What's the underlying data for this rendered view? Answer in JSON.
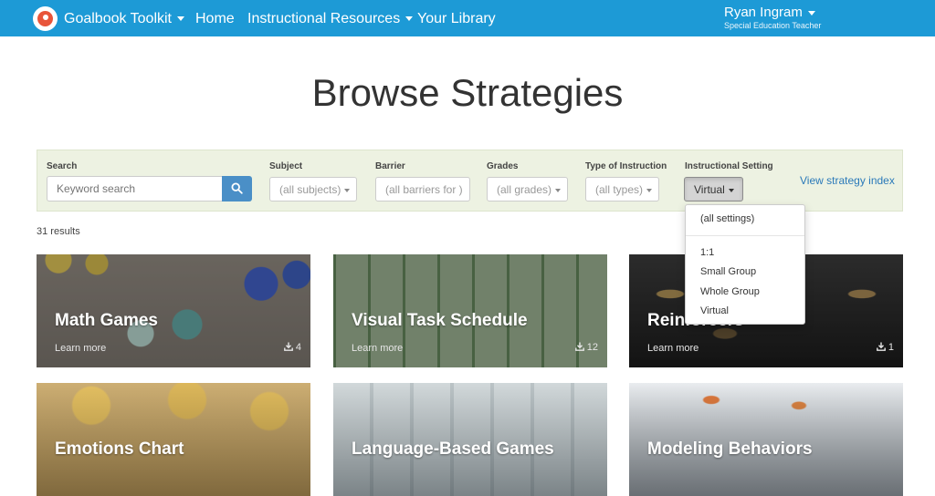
{
  "navbar": {
    "brand": "Goalbook Toolkit",
    "home": "Home",
    "resources": "Instructional Resources",
    "library": "Your Library",
    "user_name": "Ryan Ingram",
    "user_role": "Special Education Teacher",
    "bg_color": "#1d9ad6"
  },
  "page": {
    "title": "Browse Strategies"
  },
  "filters": {
    "search_label": "Search",
    "search_placeholder": "Keyword search",
    "subject_label": "Subject",
    "subject_value": "(all subjects)",
    "barrier_label": "Barrier",
    "barrier_value": "(all barriers for )",
    "grades_label": "Grades",
    "grades_value": "(all grades)",
    "type_label": "Type of Instruction",
    "type_value": "(all types)",
    "setting_label": "Instructional Setting",
    "setting_value": "Virtual",
    "index_link": "View strategy index"
  },
  "setting_menu": {
    "items": [
      "(all settings)",
      "1:1",
      "Small Group",
      "Whole Group",
      "Virtual"
    ]
  },
  "results": {
    "count": "31 results"
  },
  "cards": [
    {
      "title": "Math Games",
      "more": "Learn more",
      "downloads": "4"
    },
    {
      "title": "Visual Task Schedule",
      "more": "Learn more",
      "downloads": "12"
    },
    {
      "title": "Reinforcers",
      "more": "Learn more",
      "downloads": "1"
    },
    {
      "title": "Emotions Chart"
    },
    {
      "title": "Language-Based Games"
    },
    {
      "title": "Modeling Behaviors"
    }
  ]
}
